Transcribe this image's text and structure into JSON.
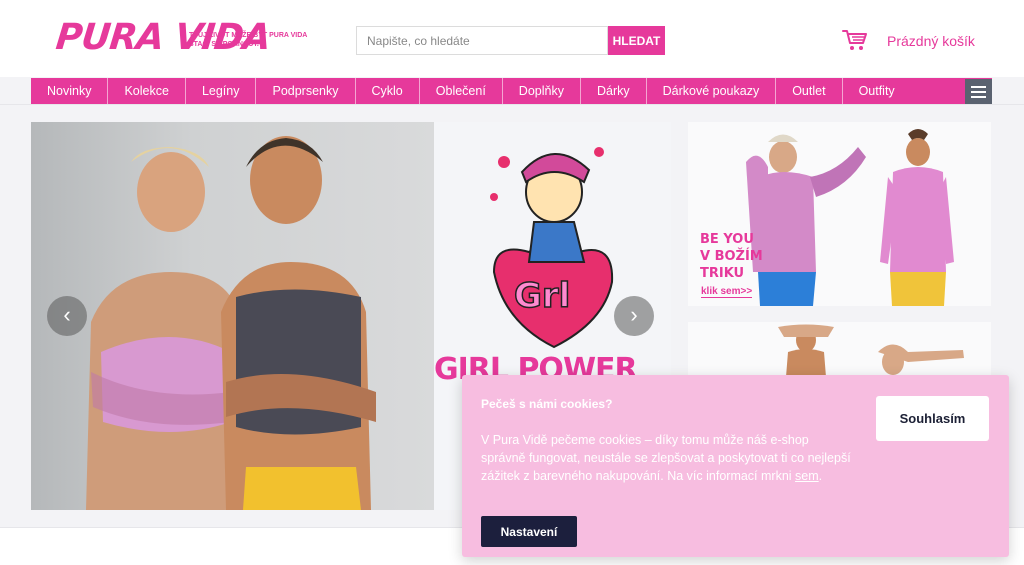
{
  "header": {
    "logo_text": "PURA VIDA",
    "tagline": "TVŮJ ŽIVOT MŮŽE BÝT PURA VIDA STAČÍ SE POHNOUT.",
    "search_placeholder": "Napište, co hledáte",
    "search_button": "HLEDAT",
    "cart_label": "Prázdný košík"
  },
  "nav": {
    "items": [
      "Novinky",
      "Kolekce",
      "Legíny",
      "Podprsenky",
      "Cyklo",
      "Oblečení",
      "Doplňky",
      "Dárky",
      "Dárkové poukazy",
      "Outlet",
      "Outfity"
    ]
  },
  "hero": {
    "prev_arrow": "‹",
    "next_arrow": "›",
    "graphic_text": "Grl",
    "banner_text": "GIRL POWER"
  },
  "promo": {
    "line1": "BE YOU",
    "line2": "V BOŽÍM",
    "line3": "TRIKU",
    "link": "klik sem>>"
  },
  "cookie": {
    "title": "Pečeš s námi cookies?",
    "text": "V Pura Vidě pečeme cookies – díky tomu může náš e-shop správně fungovat, neustále se zlepšovat a poskytovat ti co nejlepší zážitek z barevného nakupování. Na víc informací mrkni ",
    "more_link": "sem",
    "period": ".",
    "agree_button": "Souhlasím",
    "settings_button": "Nastavení"
  },
  "colors": {
    "brand_pink": "#e6399b",
    "cookie_bg": "#f7bde0",
    "dark_button": "#1c1f3d"
  }
}
